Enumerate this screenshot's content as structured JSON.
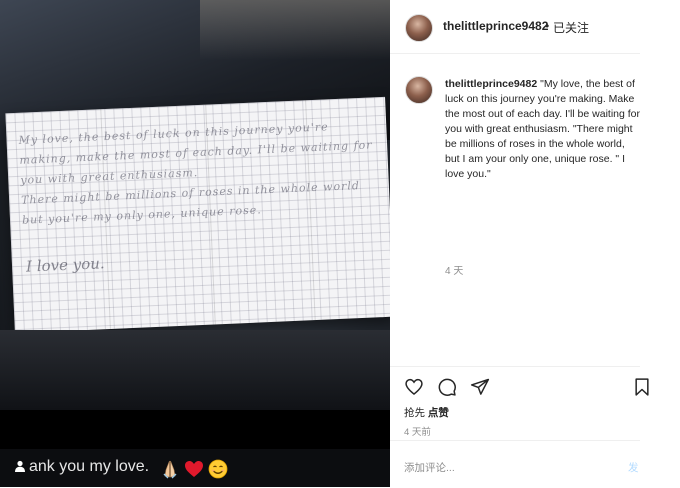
{
  "post": {
    "username": "thelittleprince9482",
    "separator": "•",
    "follow_status": "已关注"
  },
  "photo": {
    "letter_lines": [
      "My love,      the best of luck on this journey you're",
      "making,  make the most of each day. I'll be waiting for",
      "you with great enthusiasm.",
      "There might be millions of roses in the whole world",
      "but you're my only one, unique rose."
    ],
    "letter_signoff": "I love you.",
    "caption": "ank you my love.",
    "emojis": [
      "folded-hands-icon",
      "red-heart-icon",
      "smiling-face-icon"
    ]
  },
  "comment": {
    "username": "thelittleprince9482",
    "text": " \"My love, the best of luck on this journey you're making. Make the most out of each day. I'll be waiting for you with great enthusiasm. \"There might be millions of roses in the whole world, but I am your only one, unique rose. \" I love you.\"",
    "time": "4 天"
  },
  "actions": {
    "icons": [
      "heart-icon",
      "comment-icon",
      "share-icon",
      "bookmark-icon"
    ],
    "likes_prefix": "抢先 ",
    "likes_link": "点赞",
    "time": "4 天前"
  },
  "add_comment": {
    "placeholder": "添加评论...",
    "post_label": "发"
  },
  "colors": {
    "text": "#262626",
    "muted": "#8e8e8e",
    "post_button_disabled": "#b3dbff",
    "divider": "#efefef"
  }
}
